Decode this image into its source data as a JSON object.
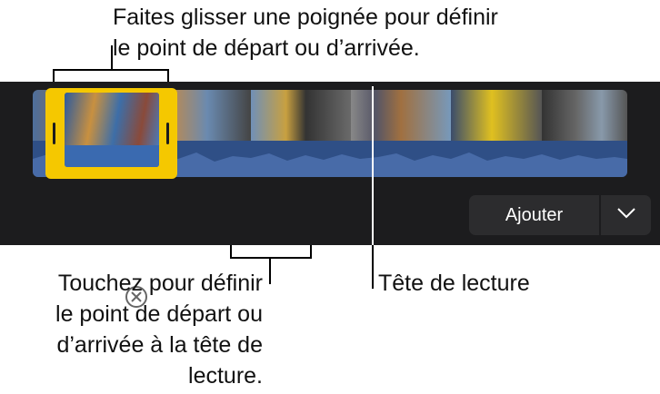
{
  "callouts": {
    "drag_handle": [
      "Faites glisser une poignée pour définir",
      "le point de départ ou d’arrivée."
    ],
    "set_point": [
      "Touchez pour définir",
      "le point de départ ou",
      "d’arrivée à la tête de",
      "lecture."
    ],
    "playhead": "Tête de lecture"
  },
  "toolbar": {
    "add_label": "Ajouter",
    "icons": [
      "heart-icon",
      "crop-off-icon",
      "clear-icon",
      "key-icon",
      "set-in-icon",
      "set-out-icon",
      "chevron-down-icon"
    ]
  },
  "colors": {
    "panel_bg": "#1c1c1e",
    "trim_handle": "#f5c800",
    "waveform": "#2f4f86",
    "button_bg": "#2c2c2e",
    "icon": "#ffffff"
  }
}
